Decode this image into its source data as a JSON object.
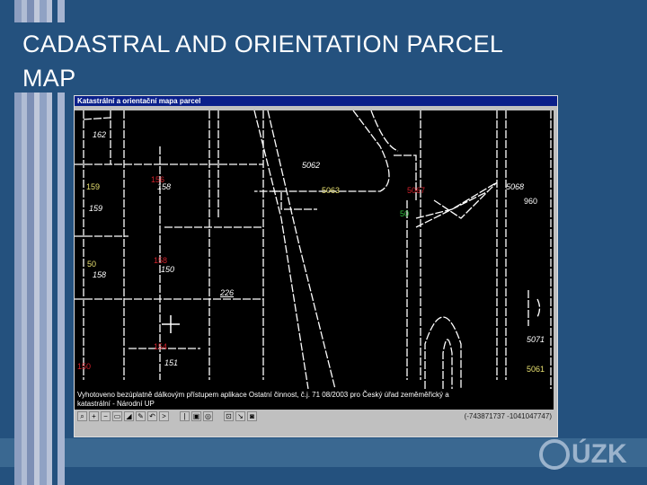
{
  "slide": {
    "title_line1": "CADASTRAL AND ORIENTATION PARCEL",
    "title_line2": "MAP"
  },
  "window": {
    "title": "Katastrální a orientační mapa parcel"
  },
  "map": {
    "labels": [
      {
        "t": "162",
        "c": "w"
      },
      {
        "t": "159",
        "c": "y"
      },
      {
        "t": "159",
        "c": "w"
      },
      {
        "t": "156",
        "c": "r"
      },
      {
        "t": "158",
        "c": "w"
      },
      {
        "t": "158",
        "c": "r"
      },
      {
        "t": "150",
        "c": "w"
      },
      {
        "t": "50",
        "c": "y"
      },
      {
        "t": "158",
        "c": "w"
      },
      {
        "t": "226",
        "c": "w"
      },
      {
        "t": "154",
        "c": "r"
      },
      {
        "t": "151",
        "c": "w"
      },
      {
        "t": "150",
        "c": "r"
      },
      {
        "t": "5062",
        "c": "w"
      },
      {
        "t": "5063",
        "c": "y"
      },
      {
        "t": "5067",
        "c": "r"
      },
      {
        "t": "5068",
        "c": "w"
      },
      {
        "t": "960",
        "c": "w"
      },
      {
        "t": "5071",
        "c": "w"
      },
      {
        "t": "5061",
        "c": "y"
      },
      {
        "t": "50",
        "c": "g"
      }
    ]
  },
  "status": {
    "line1": "Vyhotoveno bezúplatně dálkovým přístupem aplikace Ostatní činnost, č.j. 71 08/2003 pro Český úřad zeměměřický a",
    "line2": "katastrální - Národní UP"
  },
  "toolbar": {
    "buttons": [
      "zoom",
      "+",
      "−",
      "▭",
      "◢",
      "✎",
      "↶",
      ">",
      "|",
      "▣",
      "◎",
      "⊡",
      "↘",
      "◙"
    ],
    "coords": "(-743871737 -1041047747)"
  },
  "logo": {
    "text": "ÚZK"
  }
}
